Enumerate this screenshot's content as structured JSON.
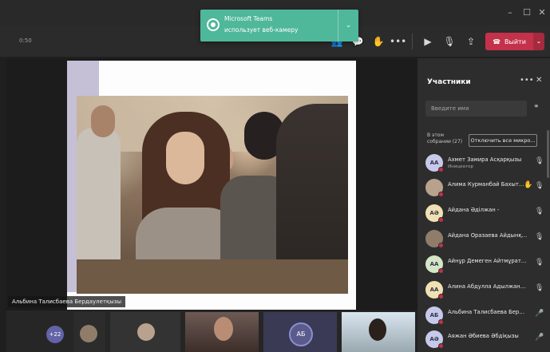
{
  "toast": {
    "title": "Microsoft Teams",
    "message": "использует веб-камеру"
  },
  "toolbar": {
    "timer": "0:50",
    "leave_label": "Выйти"
  },
  "presenter": {
    "name": "Альбина Талисбаева Бердаулетқызы"
  },
  "strip": {
    "more_count": "+22",
    "ab_initials": "АБ"
  },
  "participants_panel": {
    "title": "Участники",
    "search_placeholder": "Введите имя",
    "section_label": "В этом собрании (27)",
    "mute_all_label": "Отключить все микро...",
    "items": [
      {
        "initials": "АА",
        "name": "Ахмет Замира Асқарқызы",
        "role": "Инициатор",
        "avatar_color": "#c7c9ea"
      },
      {
        "initials": "",
        "name": "Алима Курманбай Бахыт...",
        "role": "",
        "avatar_color": "#b8a28e",
        "hand": true
      },
      {
        "initials": "АӘ",
        "name": "Айдана Әділжан -",
        "role": "",
        "avatar_color": "#f0e1b4"
      },
      {
        "initials": "",
        "name": "Айдана Оразаева Айдынқызы",
        "role": "",
        "avatar_color": "#8f7d6a"
      },
      {
        "initials": "АА",
        "name": "Айнұр Демеген Айтмұратқы...",
        "role": "",
        "avatar_color": "#d4e6c6"
      },
      {
        "initials": "АА",
        "name": "Алина Абдулла Адылжановна",
        "role": "",
        "avatar_color": "#f0e1b4"
      },
      {
        "initials": "АБ",
        "name": "Альбина Талисбаева Берда...",
        "role": "",
        "avatar_color": "#c7c9ea"
      },
      {
        "initials": "АӘ",
        "name": "Аяжан Әбиева Әбдіқызы",
        "role": "",
        "avatar_color": "#c7c9ea"
      }
    ]
  },
  "icons": {
    "hand": "✋",
    "mic_off": "🎙",
    "more": "•••"
  }
}
